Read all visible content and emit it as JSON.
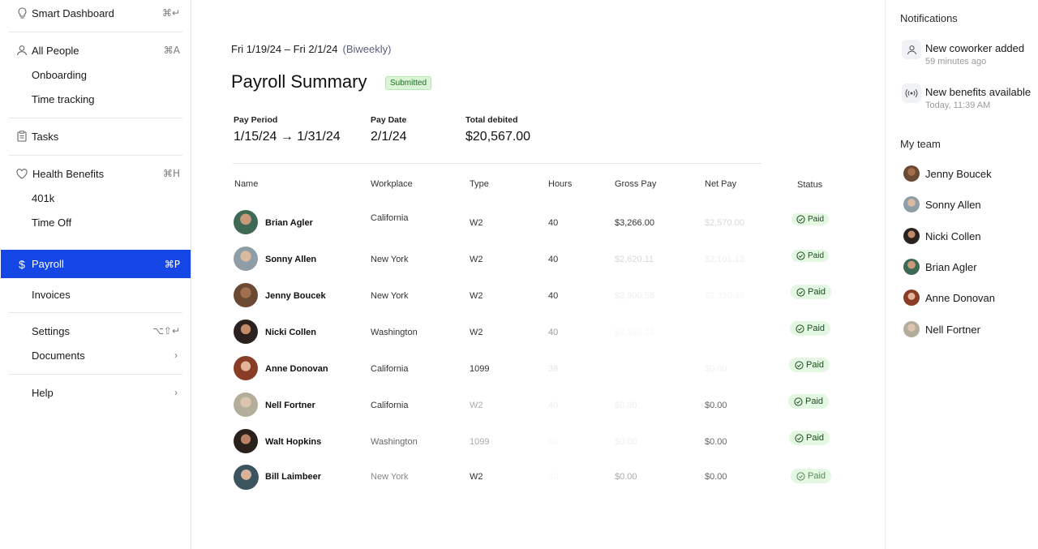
{
  "sidebar": {
    "items": [
      {
        "label": "Smart Dashboard",
        "shortcut": "⌘↵",
        "icon": "lightbulb-icon"
      },
      {
        "label": "All People",
        "shortcut": "⌘A",
        "icon": "person-icon"
      },
      {
        "label": "Onboarding"
      },
      {
        "label": "Time tracking"
      },
      {
        "label": "Tasks",
        "icon": "clipboard-icon"
      },
      {
        "label": "Health Benefits",
        "shortcut": "⌘H",
        "icon": "heart-icon"
      },
      {
        "label": "401k"
      },
      {
        "label": "Time Off"
      },
      {
        "label": "Payroll",
        "shortcut": "⌘P",
        "icon": "dollar-icon"
      },
      {
        "label": "Invoices"
      },
      {
        "label": "Settings",
        "shortcut": "⌥⇧↵"
      },
      {
        "label": "Documents",
        "chevron": "›"
      },
      {
        "label": "Help",
        "chevron": "›"
      }
    ]
  },
  "main": {
    "date_range": "Fri 1/19/24 – Fri 2/1/24",
    "frequency": "(Biweekly)",
    "title": "Payroll Summary",
    "status_badge": "Submitted",
    "meta": {
      "pay_period_label": "Pay Period",
      "pay_period_value": "1/15/24 → 1/31/24",
      "pay_date_label": "Pay Date",
      "pay_date_value": "2/1/24",
      "total_label": "Total debited",
      "total_value": "$20,567.00"
    },
    "columns": [
      "Name",
      "Workplace",
      "Type",
      "Hours",
      "Gross Pay",
      "Net Pay",
      "Status"
    ],
    "rows": [
      {
        "name": "Brian Agler",
        "workplace": "California",
        "type": "W2",
        "hours": "40",
        "gross": "$3,266.00",
        "net": "$2,570.00",
        "status": "Paid"
      },
      {
        "name": "Sonny Allen",
        "workplace": "New York",
        "type": "W2",
        "hours": "40",
        "gross": "$2,620.11",
        "net": "$2,101.12",
        "status": "Paid"
      },
      {
        "name": "Jenny Boucek",
        "workplace": "New York",
        "type": "W2",
        "hours": "40",
        "gross": "$2,900.58",
        "net": "$2,320.46",
        "status": "Paid"
      },
      {
        "name": "Nicki Collen",
        "workplace": "Washington",
        "type": "W2",
        "hours": "40",
        "gross": "$3,210.23",
        "net": "",
        "status": "Paid"
      },
      {
        "name": "Anne Donovan",
        "workplace": "California",
        "type": "1099",
        "hours": "38",
        "gross": "",
        "net": "$0.00",
        "status": "Paid"
      },
      {
        "name": "Nell Fortner",
        "workplace": "California",
        "type": "W2",
        "hours": "40",
        "gross": "$0.00",
        "net": "$0.00",
        "status": "Paid"
      },
      {
        "name": "Walt Hopkins",
        "workplace": "Washington",
        "type": "1099",
        "hours": "40",
        "gross": "$0.00",
        "net": "$0.00",
        "status": "Paid"
      },
      {
        "name": "Bill Laimbeer",
        "workplace": "New York",
        "type": "W2",
        "hours": "40",
        "gross": "$0.00",
        "net": "$0.00",
        "status": "Paid"
      }
    ]
  },
  "right_panel": {
    "notifications_title": "Notifications",
    "notifications": [
      {
        "title": "New coworker added",
        "time": "59 minutes ago",
        "icon": "person-icon"
      },
      {
        "title": "New benefits available",
        "time": "Today, 11:39 AM",
        "icon": "broadcast-icon"
      }
    ],
    "team_title": "My team",
    "team": [
      "Jenny Boucek",
      "Sonny Allen",
      "Nicki Collen",
      "Brian Agler",
      "Anne Donovan",
      "Nell Fortner"
    ]
  },
  "colors": {
    "accent": "#1546e6",
    "paid_bg": "#e3f7e2",
    "submitted_bg": "#d9f5d6"
  }
}
